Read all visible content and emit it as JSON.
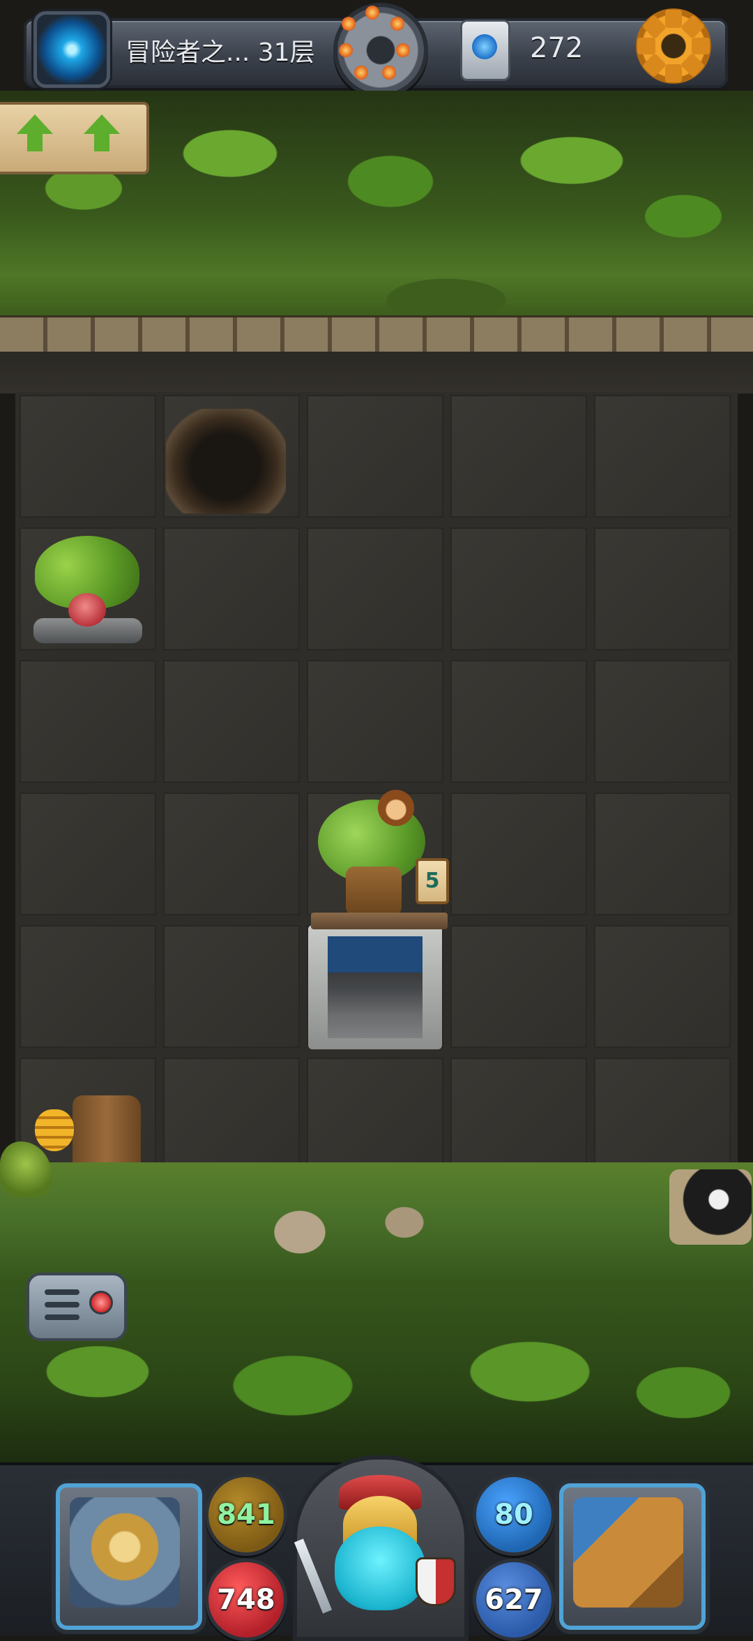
{
  "top_bar": {
    "floor_label": "冒险者之... 31层",
    "coins": "272"
  },
  "board": {
    "cols": 5,
    "rows": 6,
    "tree_house_counter": "5"
  },
  "stats": {
    "attack": "841",
    "hp": "748",
    "defense": "80",
    "mana": "627"
  },
  "icons": {
    "portal": "swirl-portal-icon",
    "bomb": "bomb-icon",
    "scroll": "blue-gem-scroll-icon",
    "settings": "gear-icon",
    "menu": "menu-list-icon",
    "equipment": "armor-shield-icon",
    "spellbook": "magic-book-icon"
  },
  "colors": {
    "attack_orb": "#7d5a14",
    "hp_orb": "#b3202a",
    "defense_orb": "#1f66b2",
    "mana_orb": "#2a5aa8",
    "attack_text": "#8ef2a0",
    "hp_text": "#ffffff",
    "defense_text": "#9ff0ff",
    "mana_text": "#ffffff"
  }
}
